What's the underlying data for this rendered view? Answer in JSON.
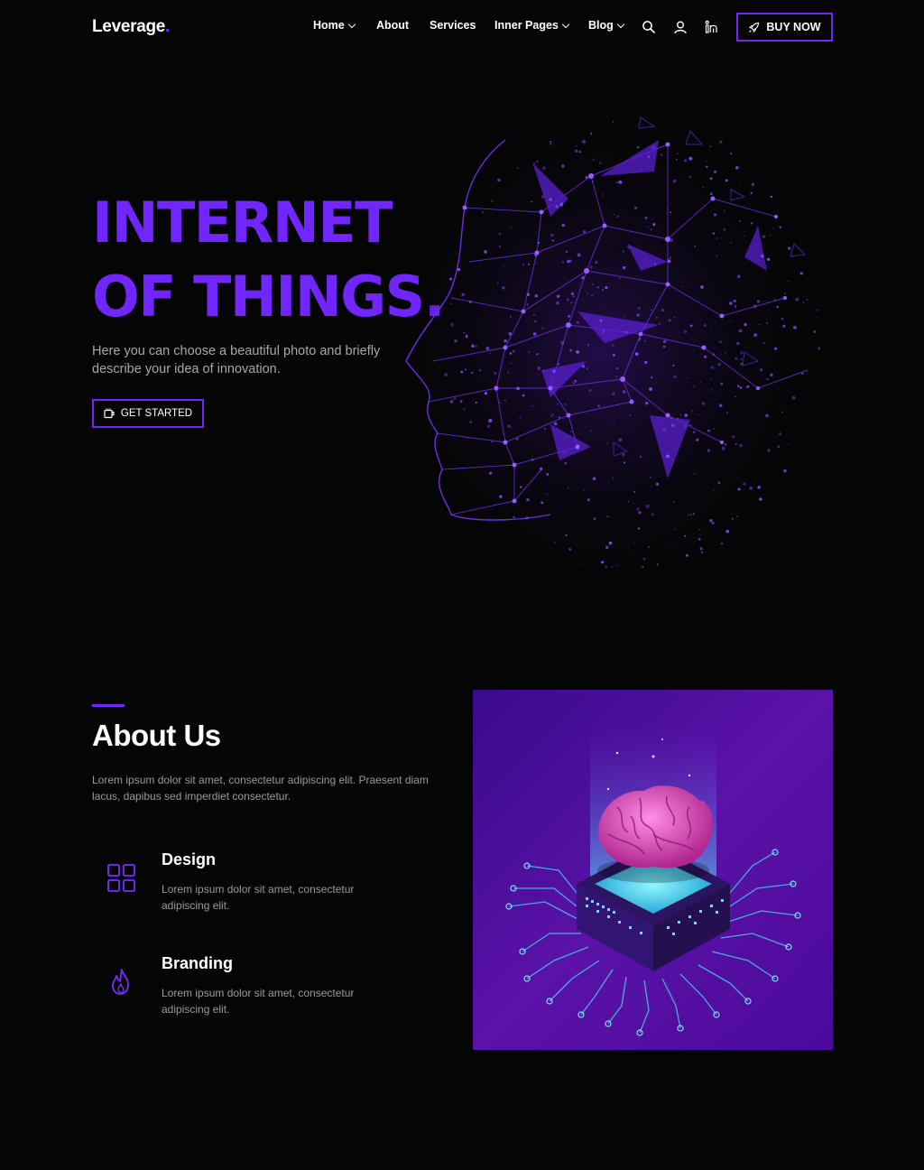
{
  "header": {
    "logo": "Leverage",
    "logo_dot": ".",
    "nav": {
      "home": "Home",
      "about": "About",
      "services": "Services",
      "inner_pages": "Inner Pages",
      "blog": "Blog"
    },
    "icons": [
      "search-icon",
      "user-icon",
      "linkedin-icon"
    ],
    "buy_button": "BUY NOW"
  },
  "hero": {
    "title_line1": "INTERNET",
    "title_line2": "OF THINGS.",
    "subtitle": "Here you can choose a beautiful photo and briefly describe your idea of innovation.",
    "cta": "GET STARTED"
  },
  "about": {
    "title": "About Us",
    "description": "Lorem ipsum dolor sit amet, consectetur adipiscing elit. Praesent diam lacus, dapibus sed imperdiet consectetur.",
    "features": [
      {
        "title": "Design",
        "text": "Lorem ipsum dolor sit amet, consectetur adipiscing elit.",
        "icon": "grid-icon"
      },
      {
        "title": "Branding",
        "text": "Lorem ipsum dolor sit amet, consectetur adipiscing elit.",
        "icon": "flame-icon"
      }
    ]
  },
  "colors": {
    "accent": "#7226ff",
    "background": "#050505",
    "muted_text": "#9a9a9a"
  }
}
